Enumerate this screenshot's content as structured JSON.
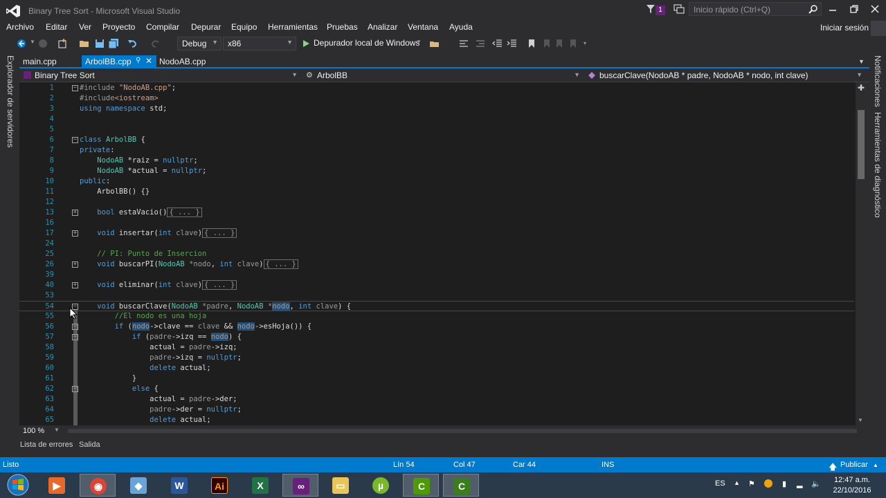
{
  "window": {
    "title": "Binary Tree Sort - Microsoft Visual Studio",
    "notification_count": "1",
    "quick_launch_placeholder": "Inicio rápido (Ctrl+Q)"
  },
  "menu": {
    "items": [
      "Archivo",
      "Editar",
      "Ver",
      "Proyecto",
      "Compilar",
      "Depurar",
      "Equipo",
      "Herramientas",
      "Pruebas",
      "Analizar",
      "Ventana",
      "Ayuda"
    ],
    "signin": "Iniciar sesión"
  },
  "toolbar": {
    "configuration": "Debug",
    "platform": "x86",
    "run_label": "Depurador local de Windows"
  },
  "sidebars": {
    "left": "Explorador de servidores",
    "right_1": "Notificaciones",
    "right_2": "Herramientas de diagnóstico"
  },
  "tabs": [
    {
      "label": "main.cpp",
      "active": false
    },
    {
      "label": "ArbolBB.cpp",
      "active": true
    },
    {
      "label": "NodoAB.cpp",
      "active": false
    }
  ],
  "navbar": {
    "project": "Binary Tree Sort",
    "scope": "ArbolBB",
    "member": "buscarClave(NodoAB * padre, NodoAB * nodo, int clave)"
  },
  "editor": {
    "current_line": "54",
    "line_numbers": [
      "1",
      "2",
      "3",
      "4",
      "5",
      "6",
      "7",
      "8",
      "9",
      "10",
      "11",
      "12",
      "13",
      "16",
      "17",
      "24",
      "25",
      "26",
      "39",
      "40",
      "53",
      "54",
      "55",
      "56",
      "57",
      "58",
      "59",
      "60",
      "61",
      "62",
      "63",
      "64",
      "65"
    ]
  },
  "editor_footer": {
    "zoom": "100 %"
  },
  "tool_tabs": [
    "Lista de errores",
    "Salida"
  ],
  "status": {
    "state": "Listo",
    "line": "Lín 54",
    "col": "Col 47",
    "char": "Car 44",
    "mode": "INS",
    "publish": "Publicar"
  },
  "taskbar": {
    "language": "ES",
    "time": "12:47 a.m.",
    "date": "22/10/2016",
    "apps": [
      "media-player",
      "chrome",
      "app-cube",
      "word",
      "illustrator",
      "excel",
      "visual-studio",
      "file-explorer",
      "utorrent",
      "camtasia-recorder",
      "camtasia-studio"
    ]
  },
  "colors": {
    "accent": "#007acc",
    "keyword": "#569cd6",
    "type": "#4ec9b0",
    "string": "#d69d85",
    "comment": "#57a64a",
    "line_number": "#2b91af"
  }
}
